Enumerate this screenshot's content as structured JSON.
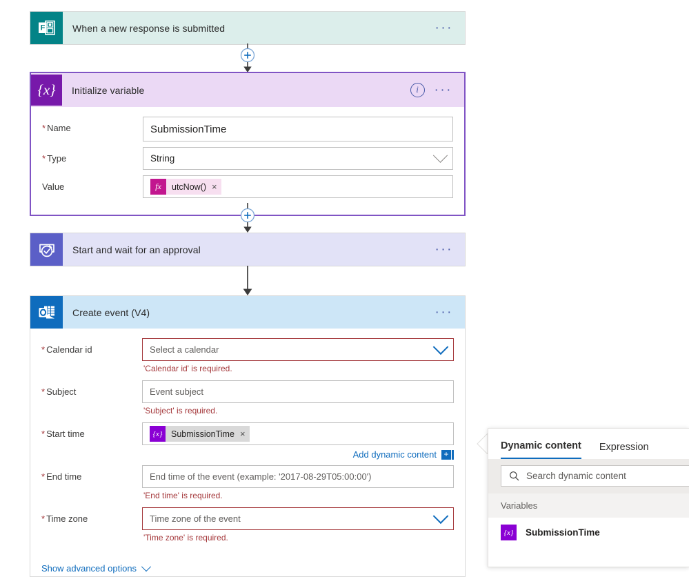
{
  "flow": {
    "steps": [
      {
        "id": "trigger",
        "title": "When a new response is submitted",
        "icon": "microsoft-forms-icon",
        "more_label": "···"
      },
      {
        "id": "initialize-variable",
        "title": "Initialize variable",
        "icon": "variable-icon",
        "info_glyph": "i",
        "more_label": "···",
        "fields": {
          "name": {
            "label": "Name",
            "required": true,
            "value": "SubmissionTime"
          },
          "type": {
            "label": "Type",
            "required": true,
            "value": "String"
          },
          "value": {
            "label": "Value",
            "required": false,
            "token": {
              "badge": "fx",
              "text": "utcNow()",
              "remove": "×"
            }
          }
        }
      },
      {
        "id": "start-and-wait-for-approval",
        "title": "Start and wait for an approval",
        "icon": "approval-icon",
        "more_label": "···"
      },
      {
        "id": "create-event-v4",
        "title": "Create event (V4)",
        "icon": "outlook-calendar-icon",
        "more_label": "···",
        "fields": {
          "calendar_id": {
            "label": "Calendar id",
            "required": true,
            "placeholder": "Select a calendar",
            "error": "'Calendar id' is required."
          },
          "subject": {
            "label": "Subject",
            "required": true,
            "placeholder": "Event subject",
            "error": "'Subject' is required."
          },
          "start_time": {
            "label": "Start time",
            "required": true,
            "token": {
              "badge": "{x}",
              "text": "SubmissionTime",
              "remove": "×"
            },
            "add_dynamic_content": "Add dynamic content"
          },
          "end_time": {
            "label": "End time",
            "required": true,
            "placeholder": "End time of the event (example: '2017-08-29T05:00:00')",
            "error": "'End time' is required."
          },
          "time_zone": {
            "label": "Time zone",
            "required": true,
            "placeholder": "Time zone of the event",
            "error": "'Time zone' is required."
          }
        },
        "advanced_options_label": "Show advanced options"
      }
    ],
    "connector_add_label": "+"
  },
  "dynamic_content_panel": {
    "tabs": [
      {
        "label": "Dynamic content",
        "active": true
      },
      {
        "label": "Expression",
        "active": false
      }
    ],
    "search": {
      "placeholder": "Search dynamic content",
      "value": ""
    },
    "group_label": "Variables",
    "items": [
      {
        "label": "SubmissionTime",
        "badge": "{x}"
      }
    ]
  },
  "colors": {
    "forms_teal": "#038387",
    "variable_purple": "#7719aa",
    "approval_indigo": "#5b5fc7",
    "outlook_blue": "#0f6cbd",
    "selected_border": "#8054c4",
    "error_red": "#a4373a",
    "link_blue": "#0f6cbd",
    "token_fx_magenta": "#c2168f",
    "token_var_purple": "#8a00d4"
  }
}
